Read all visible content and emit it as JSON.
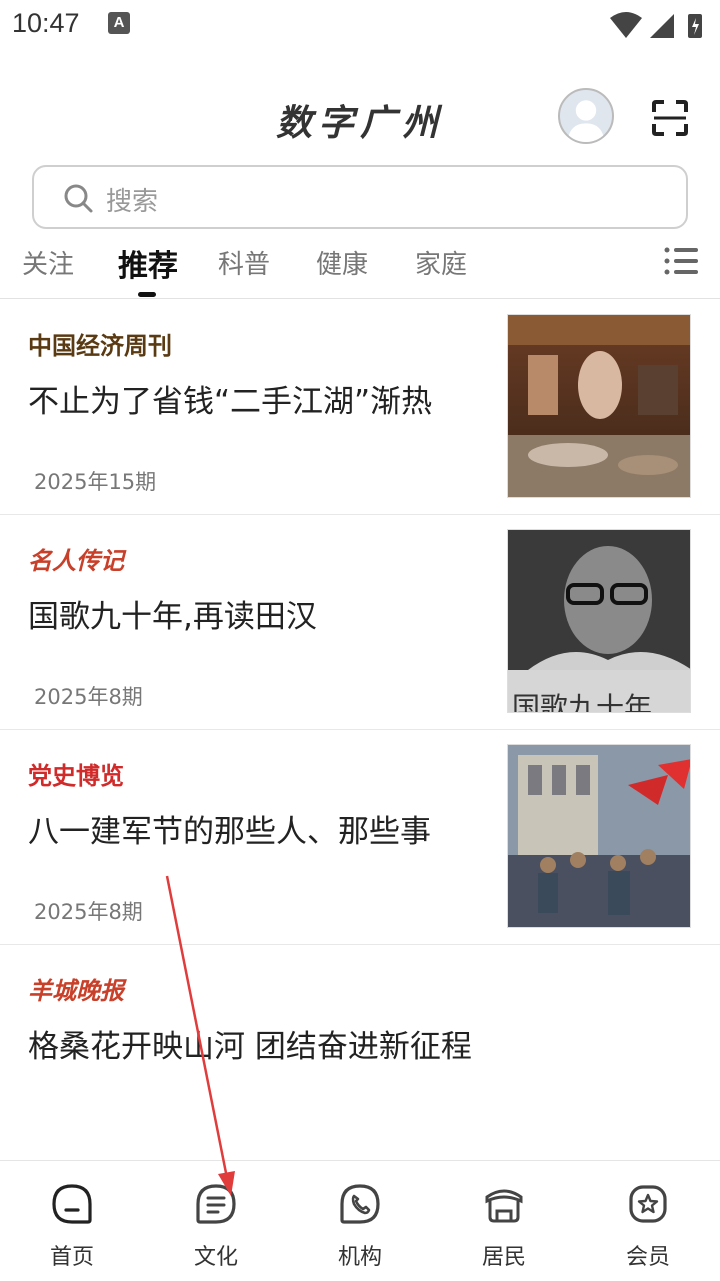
{
  "status_bar": {
    "time": "10:47",
    "notif_badge": "A"
  },
  "header": {
    "title": "数字广州"
  },
  "search": {
    "placeholder": "搜索"
  },
  "tabs": [
    {
      "label": "关注",
      "active": false
    },
    {
      "label": "推荐",
      "active": true
    },
    {
      "label": "科普",
      "active": false
    },
    {
      "label": "健康",
      "active": false
    },
    {
      "label": "家庭",
      "active": false
    }
  ],
  "articles": [
    {
      "source": "中国经济周刊",
      "source_color": "#5a3a12",
      "headline": "不止为了省钱“二手江湖”渐热",
      "date": "2025年15期"
    },
    {
      "source": "名人传记",
      "source_color": "#c8402a",
      "headline": "国歌九十年,再读田汉",
      "date": "2025年8期",
      "thumb_caption": "国歌九十年"
    },
    {
      "source": "党史博览",
      "source_color": "#d02a2a",
      "headline": "八一建军节的那些人、那些事",
      "date": "2025年8期"
    },
    {
      "source": "羊城晚报",
      "source_color": "#c8402a",
      "headline": "格桑花开映山河 团结奋进新征程"
    }
  ],
  "bottom_nav": [
    {
      "label": "首页",
      "icon": "home-face-icon"
    },
    {
      "label": "文化",
      "icon": "document-icon"
    },
    {
      "label": "机构",
      "icon": "phone-icon"
    },
    {
      "label": "居民",
      "icon": "resident-icon"
    },
    {
      "label": "会员",
      "icon": "member-star-icon"
    }
  ],
  "colors": {
    "annotation_arrow": "#e03c3c",
    "active_tab": "#111111"
  }
}
